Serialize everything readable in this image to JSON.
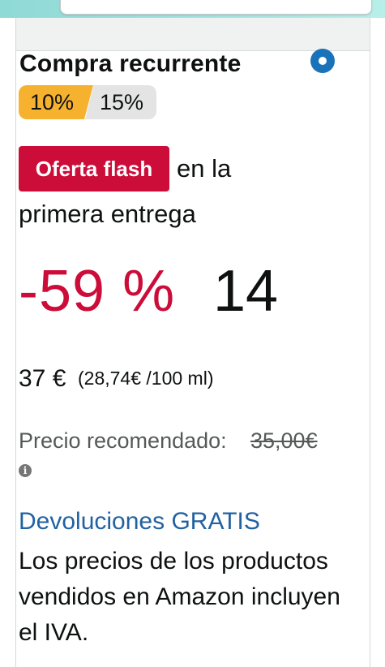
{
  "header": {
    "search_placeholder": ""
  },
  "subscription": {
    "title": "Compra recurrente",
    "selected": true,
    "segments": [
      "10%",
      "15%"
    ],
    "active_segment": "10%"
  },
  "deal": {
    "badge": "Oferta flash",
    "text_line1": "en la",
    "text_line2": "primera entrega",
    "discount": "-59 %",
    "price_main": "14",
    "price_rest": "37 €",
    "unit_price": "(28,74€ /100 ml)"
  },
  "rrp": {
    "label": "Precio recomendado:",
    "value": "35,00€"
  },
  "returns": {
    "link": "Devoluciones GRATIS"
  },
  "tax_note": "Los precios de los productos vendidos en Amazon incluyen el IVA.",
  "colors": {
    "accent_blue": "#1a73b8",
    "deal_red": "#cc0c39",
    "segment_active": "#f6b12f",
    "link_blue": "#2162a1"
  }
}
